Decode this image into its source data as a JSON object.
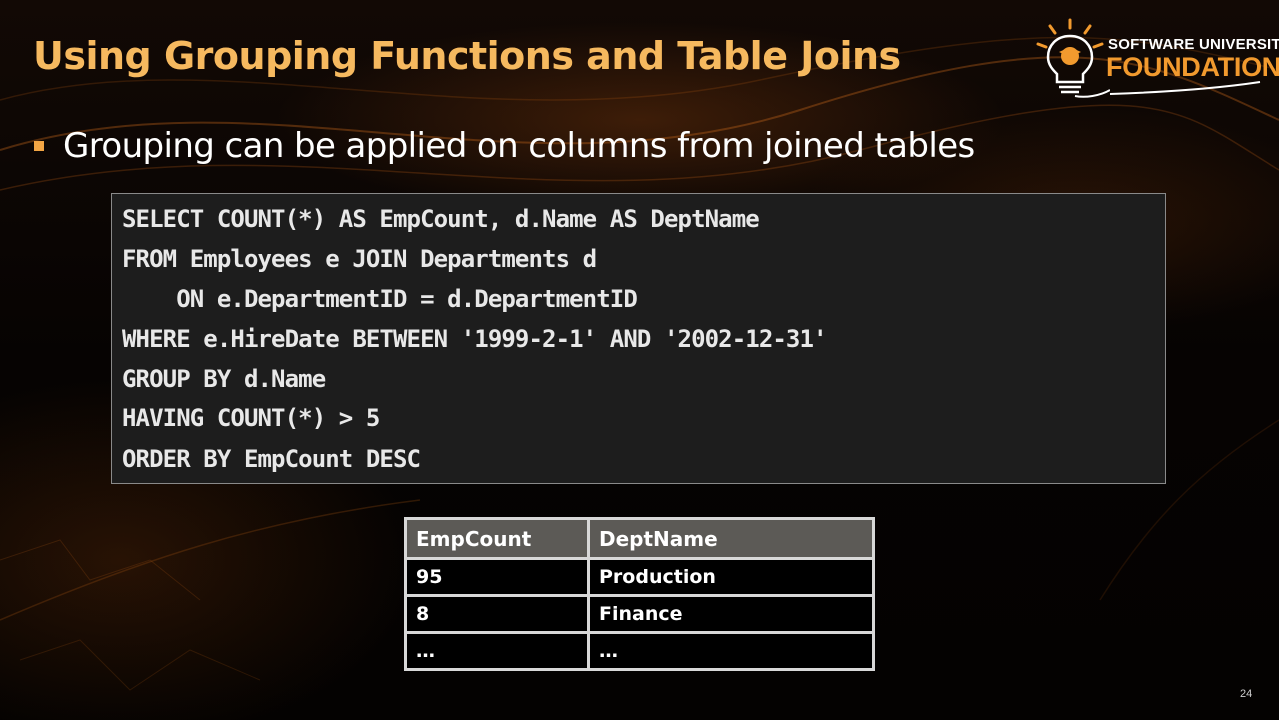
{
  "slide": {
    "title": "Using Grouping Functions and Table Joins",
    "bullet": "Grouping can be applied on columns from joined tables",
    "page_number": "24"
  },
  "logo": {
    "line1": "SOFTWARE UNIVERSITY",
    "line2": "FOUNDATION",
    "icon": "lightbulb-head-icon"
  },
  "code": {
    "lines": [
      "SELECT COUNT(*) AS EmpCount, d.Name AS DeptName",
      "FROM Employees e JOIN Departments d",
      "    ON e.DepartmentID = d.DepartmentID",
      "WHERE e.HireDate BETWEEN '1999-2-1' AND '2002-12-31'",
      "GROUP BY d.Name",
      "HAVING COUNT(*) > 5",
      "ORDER BY EmpCount DESC"
    ]
  },
  "result": {
    "headers": [
      "EmpCount",
      "DeptName"
    ],
    "rows": [
      [
        "95",
        "Production"
      ],
      [
        "8",
        "Finance"
      ],
      [
        "…",
        "…"
      ]
    ]
  },
  "colors": {
    "title": "#f6b95f",
    "bullet": "#f3a544",
    "accent": "#f29a2e",
    "code_bg": "#1d1d1d",
    "table_header_bg": "#5c5a56"
  }
}
